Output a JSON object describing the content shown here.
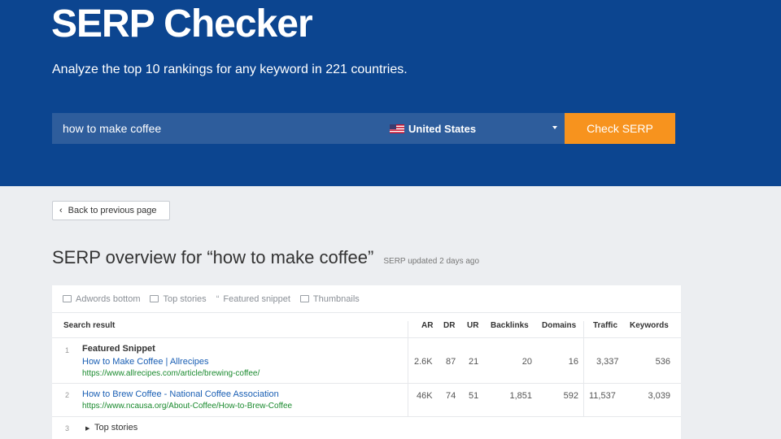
{
  "hero": {
    "title": "SERP Checker",
    "subtitle": "Analyze the top 10 rankings for any keyword in 221 countries."
  },
  "search": {
    "keyword": "how to make coffee",
    "country": "United States",
    "button_label": "Check SERP"
  },
  "back_button": {
    "label": "Back to previous page"
  },
  "overview": {
    "title": "SERP overview for “how to make coffee”",
    "updated": "SERP updated 2 days ago"
  },
  "features": [
    {
      "icon": "adwords-icon",
      "label": "Adwords bottom"
    },
    {
      "icon": "top-stories-icon",
      "label": "Top stories"
    },
    {
      "icon": "quote-icon",
      "label": "Featured snippet"
    },
    {
      "icon": "thumbnails-icon",
      "label": "Thumbnails"
    }
  ],
  "table": {
    "headers": {
      "search_result": "Search result",
      "ar": "AR",
      "dr": "DR",
      "ur": "UR",
      "backlinks": "Backlinks",
      "domains": "Domains",
      "traffic": "Traffic",
      "keywords": "Keywords"
    },
    "rows": [
      {
        "num": "1",
        "feature": "Featured Snippet",
        "title": "How to Make Coffee | Allrecipes",
        "url": "https://www.allrecipes.com/article/brewing-coffee/",
        "ar": "2.6K",
        "dr": "87",
        "ur": "21",
        "backlinks": "20",
        "domains": "16",
        "traffic": "3,337",
        "keywords": "536"
      },
      {
        "num": "2",
        "title": "How to Brew Coffee - National Coffee Association",
        "url": "https://www.ncausa.org/About-Coffee/How-to-Brew-Coffee",
        "ar": "46K",
        "dr": "74",
        "ur": "51",
        "backlinks": "1,851",
        "domains": "592",
        "traffic": "11,537",
        "keywords": "3,039"
      },
      {
        "num": "3",
        "label": "Top stories"
      }
    ]
  },
  "colors": {
    "hero_bg": "#0c4590",
    "search_bg": "#2e5d9c",
    "button_bg": "#f7931e",
    "link": "#1a5fb4",
    "url": "#1a8a2e"
  }
}
